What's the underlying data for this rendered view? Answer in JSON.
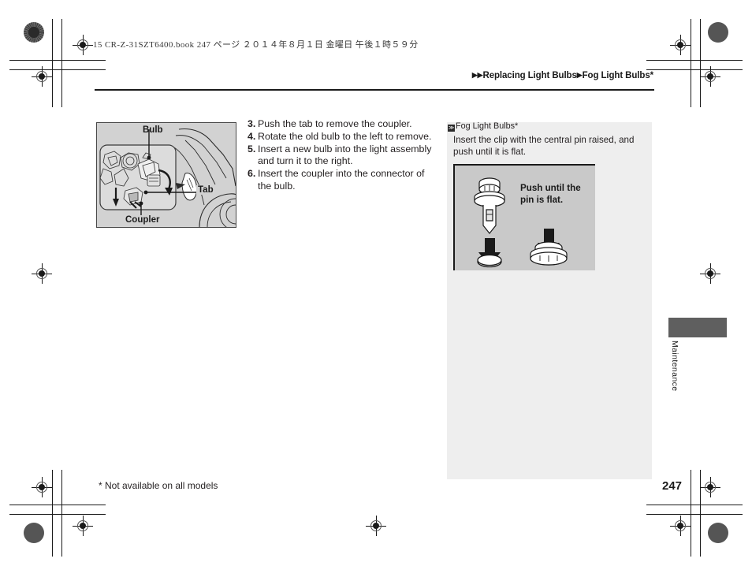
{
  "print_marks": {
    "file_slug": "15 CR-Z-31SZT6400.book   247 ページ   ２０１４年８月１日   金曜日   午後１時５９分"
  },
  "header": {
    "breadcrumb": {
      "arrow_double": "▶▶",
      "arrow_single": "▶",
      "level1": "Replacing Light Bulbs",
      "level2": "Fog Light Bulbs*"
    }
  },
  "main": {
    "figure": {
      "labels": {
        "bulb": "Bulb",
        "tab": "Tab",
        "coupler": "Coupler"
      }
    },
    "steps": [
      {
        "number": "3.",
        "text": "Push the tab to remove the coupler."
      },
      {
        "number": "4.",
        "text": "Rotate the old bulb to the left to remove."
      },
      {
        "number": "5.",
        "text": "Insert a new bulb into the light assembly and turn it to the right."
      },
      {
        "number": "6.",
        "text": "Insert the coupler into the connector of the bulb."
      }
    ],
    "footnote": "* Not available on all models"
  },
  "note": {
    "marker": "≫",
    "title": "Fog Light Bulbs*",
    "body": "Insert the clip with the central pin raised, and push until it is flat.",
    "figure_caption": "Push until the\npin is flat."
  },
  "side_tab": {
    "label": "Maintenance"
  },
  "footer": {
    "page_number": "247"
  },
  "colors": {
    "ink": "#231f20",
    "figure_fill": "#d2d2d2",
    "note_panel": "#eeeeee",
    "note_figure_fill": "#c9c9c9",
    "side_tab": "#5f5f5f"
  }
}
